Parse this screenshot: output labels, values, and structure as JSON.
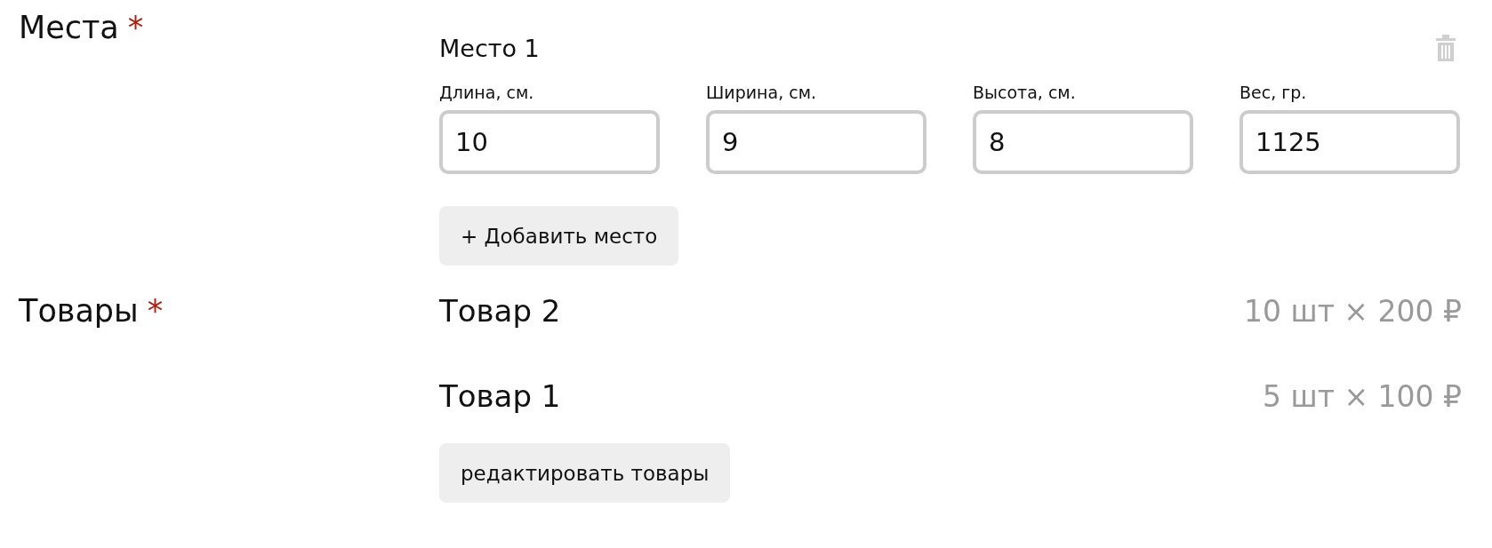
{
  "places_section": {
    "label": "Места",
    "required_mark": "*",
    "places": [
      {
        "title": "Место 1",
        "fields": [
          {
            "label": "Длина, см.",
            "value": "10"
          },
          {
            "label": "Ширина, см.",
            "value": "9"
          },
          {
            "label": "Высота, см.",
            "value": "8"
          },
          {
            "label": "Вес, гр.",
            "value": "1125"
          }
        ]
      }
    ],
    "add_button": "+ Добавить место"
  },
  "goods_section": {
    "label": "Товары",
    "required_mark": "*",
    "items": [
      {
        "name": "Товар 2",
        "quantity_price": "10 шт × 200 ₽"
      },
      {
        "name": "Товар 1",
        "quantity_price": "5 шт × 100 ₽"
      }
    ],
    "edit_button": "редактировать товары"
  }
}
